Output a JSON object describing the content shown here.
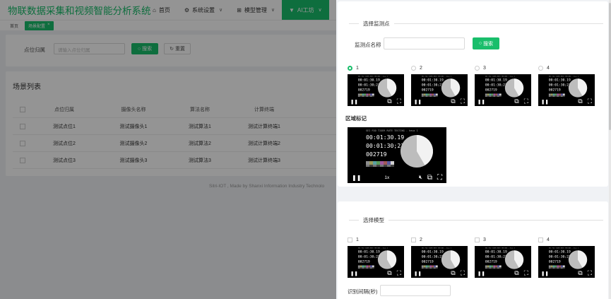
{
  "app": {
    "brand": "物联数据采集和视频智能分析系统",
    "nav": [
      {
        "icon": "⌂",
        "icon_name": "home-icon",
        "label": "首页",
        "chevron": false,
        "active": false
      },
      {
        "icon": "⚙",
        "icon_name": "gear-icon",
        "label": "系统设置",
        "chevron": true,
        "active": false
      },
      {
        "icon": "⊞",
        "icon_name": "model-icon",
        "label": "模型管理",
        "chevron": true,
        "active": false
      },
      {
        "icon": "▼",
        "icon_name": "ai-icon",
        "label": "AI工坊",
        "chevron": true,
        "active": true
      }
    ],
    "tags": {
      "home": "首页",
      "active": "场景配置",
      "close": "×"
    },
    "search": {
      "label": "点位归属",
      "placeholder": "请输入点位归属",
      "search_btn": "搜索",
      "reset_btn": "重置"
    },
    "list": {
      "title": "场景列表",
      "columns": [
        "点位归属",
        "摄像头名称",
        "算法名称",
        "计算终端"
      ],
      "rows": [
        [
          "测试点位1",
          "测试摄像头1",
          "测试算法1",
          "测试计算终端1"
        ],
        [
          "测试点位2",
          "测试摄像头2",
          "测试算法2",
          "测试计算终端2"
        ],
        [
          "测试点位3",
          "测试摄像头3",
          "测试算法3",
          "测试计算终端3"
        ]
      ]
    },
    "footer": "Sitri-IOT , Made by Shanxi Information Industry Technolo"
  },
  "drawer": {
    "section1": {
      "title": "选择监测点",
      "name_label": "监测点名称",
      "name_value": "",
      "search_btn": "搜索",
      "options": [
        "1",
        "2",
        "3",
        "4"
      ],
      "selected_index": 0
    },
    "region": {
      "title": "区域标记",
      "speed": "1x"
    },
    "section2": {
      "title": "选择模型",
      "options": [
        "1",
        "2",
        "3",
        "4"
      ],
      "interval_label": "识别间隔(秒)",
      "interval_value": ""
    },
    "video": {
      "header": "SEI FOO TIGER RUTE TESTING - heux 1",
      "time1": "00:01:30.19",
      "time2": "00:01:30;21",
      "frame": "002719"
    }
  },
  "colors": {
    "accent": "#19be6b",
    "overlay": "rgba(0,0,0,0.42)",
    "page_bg": "#f0f2f5"
  }
}
